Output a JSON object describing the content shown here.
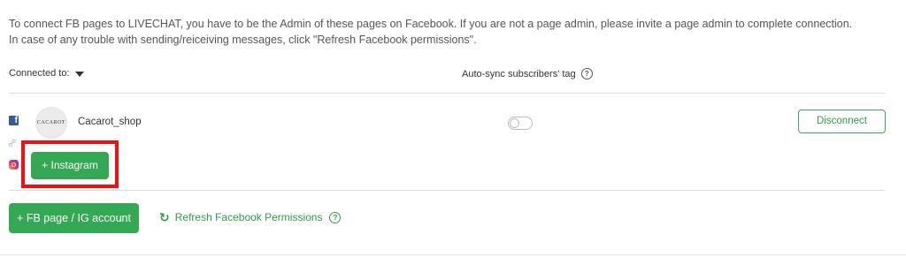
{
  "notice": {
    "line1": "To connect FB pages to LIVECHAT, you have to be the Admin of these pages on Facebook. If you are not a page admin, please invite a page admin to complete connection.",
    "line2": "In case of any trouble with sending/reiceiving messages, click \"Refresh Facebook permissions\"."
  },
  "header": {
    "connected_to": "Connected to:",
    "autosync": "Auto-sync subscribers' tag",
    "help_glyph": "?"
  },
  "connection": {
    "platform_icons": [
      "facebook-icon",
      "link-icon",
      "instagram-icon"
    ],
    "avatar_text": "CACAROT",
    "page_name": "Cacarot_shop",
    "autosync_enabled": false,
    "disconnect_label": "Disconnect",
    "instagram_button_label": "+ Instagram",
    "highlight_color": "#f20f0f"
  },
  "actions": {
    "add_button_label": "+ FB page / IG account",
    "refresh_label": "Refresh Facebook Permissions",
    "refresh_icon": "↻",
    "help_glyph": "?"
  },
  "colors": {
    "accent_green": "#34a852",
    "facebook_blue": "#3b5998"
  }
}
